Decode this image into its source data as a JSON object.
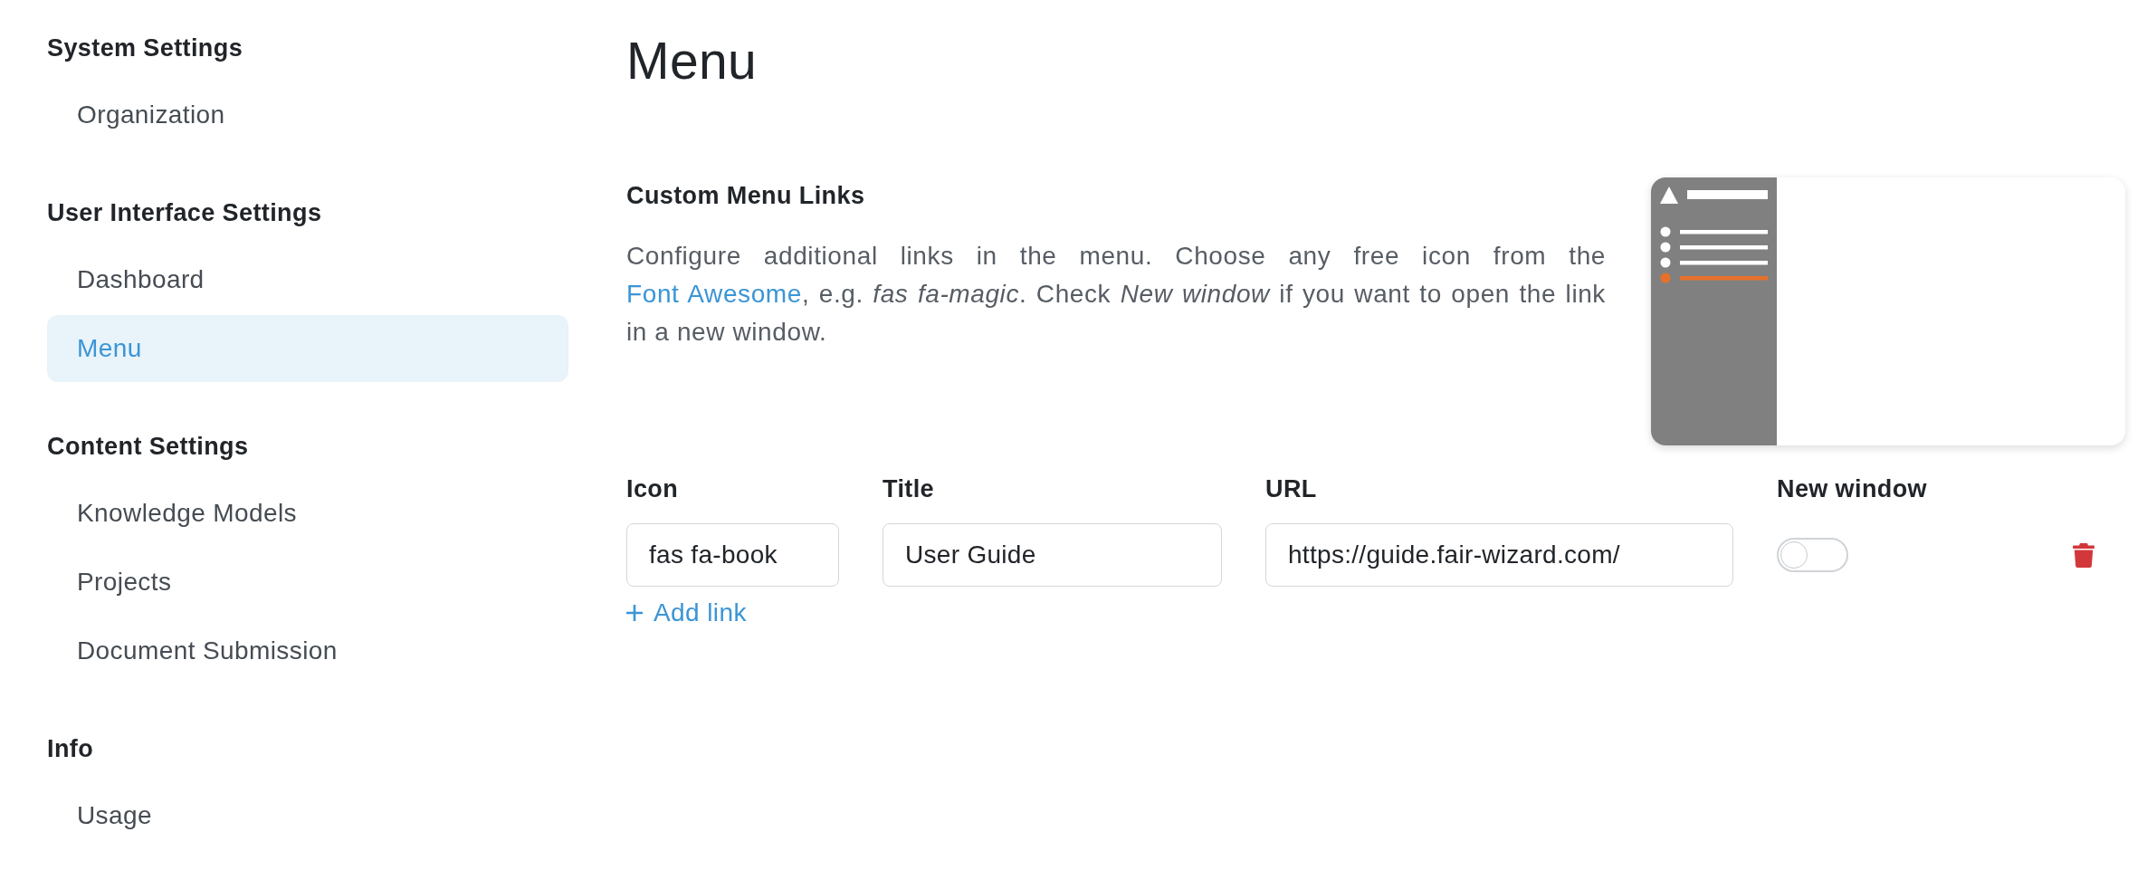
{
  "sidebar": {
    "sections": [
      {
        "title": "System Settings",
        "items": [
          {
            "label": "Organization",
            "selected": false
          }
        ]
      },
      {
        "title": "User Interface Settings",
        "items": [
          {
            "label": "Dashboard",
            "selected": false
          },
          {
            "label": "Menu",
            "selected": true
          }
        ]
      },
      {
        "title": "Content Settings",
        "items": [
          {
            "label": "Knowledge Models",
            "selected": false
          },
          {
            "label": "Projects",
            "selected": false
          },
          {
            "label": "Document Submission",
            "selected": false
          }
        ]
      },
      {
        "title": "Info",
        "items": [
          {
            "label": "Usage",
            "selected": false
          }
        ]
      }
    ]
  },
  "page": {
    "title": "Menu"
  },
  "custom_menu_links": {
    "title": "Custom Menu Links",
    "description": [
      {
        "kind": "text",
        "text": "Configure additional links in the menu. Choose any free icon from the "
      },
      {
        "kind": "link",
        "text": "Font Awesome"
      },
      {
        "kind": "text",
        "text": ", e.g. *fas fa-magic*. Check *New window* if you want to open the link in a new window."
      }
    ],
    "columns": [
      "Icon",
      "Title",
      "URL",
      "New window"
    ],
    "links": [
      {
        "icon": "fas fa-book",
        "title": "User Guide",
        "url": "https://guide.fair-wizard.com/",
        "new_window": false
      }
    ],
    "add_button": {
      "label": "Add link"
    }
  }
}
